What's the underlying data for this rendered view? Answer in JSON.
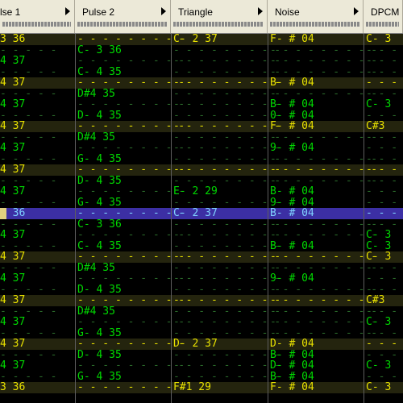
{
  "channels": [
    {
      "name": "lse 1"
    },
    {
      "name": "Pulse 2"
    },
    {
      "name": "Triangle"
    },
    {
      "name": "Noise"
    },
    {
      "name": "DPCM"
    }
  ],
  "rows": [
    {
      "hl": true,
      "cur": false,
      "c": [
        "3 36",
        "",
        "C- 2 37",
        "F- # 04",
        "C- 3"
      ]
    },
    {
      "hl": false,
      "cur": false,
      "c": [
        "",
        "C- 3 36",
        "",
        "",
        ""
      ]
    },
    {
      "hl": false,
      "cur": false,
      "c": [
        "4 37",
        "",
        "",
        "",
        ""
      ]
    },
    {
      "hl": false,
      "cur": false,
      "c": [
        "",
        "C- 4 35",
        "",
        "",
        ""
      ]
    },
    {
      "hl": true,
      "cur": false,
      "c": [
        "4 37",
        "",
        "",
        "B- # 04",
        ""
      ]
    },
    {
      "hl": false,
      "cur": false,
      "c": [
        "",
        "D#4 35",
        "",
        "",
        ""
      ]
    },
    {
      "hl": false,
      "cur": false,
      "c": [
        "4 37",
        "",
        "",
        "B- # 04",
        "C- 3"
      ]
    },
    {
      "hl": false,
      "cur": false,
      "c": [
        "",
        "D- 4 35",
        "",
        "0- # 04",
        ""
      ]
    },
    {
      "hl": true,
      "cur": false,
      "c": [
        "4 37",
        "",
        "",
        "F- # 04",
        "C#3"
      ]
    },
    {
      "hl": false,
      "cur": false,
      "c": [
        "",
        "D#4 35",
        "",
        "",
        ""
      ]
    },
    {
      "hl": false,
      "cur": false,
      "c": [
        "4 37",
        "",
        "",
        "9- # 04",
        ""
      ]
    },
    {
      "hl": false,
      "cur": false,
      "c": [
        "",
        "G- 4 35",
        "",
        "",
        ""
      ]
    },
    {
      "hl": true,
      "cur": false,
      "c": [
        "4 37",
        "",
        "",
        "",
        ""
      ]
    },
    {
      "hl": false,
      "cur": false,
      "c": [
        "",
        "D- 4 35",
        "",
        "",
        ""
      ]
    },
    {
      "hl": false,
      "cur": false,
      "c": [
        "4 37",
        "",
        "E- 2 29",
        "B- # 04",
        ""
      ]
    },
    {
      "hl": false,
      "cur": false,
      "c": [
        "",
        "G- 4 35",
        "",
        "9- # 04",
        ""
      ]
    },
    {
      "hl": false,
      "cur": true,
      "c": [
        "3 36",
        "",
        "C- 2 37",
        "B- # 04",
        ""
      ]
    },
    {
      "hl": false,
      "cur": false,
      "c": [
        "",
        "C- 3 36",
        "",
        "",
        ""
      ]
    },
    {
      "hl": false,
      "cur": false,
      "c": [
        "4 37",
        "",
        "",
        "",
        "C- 3"
      ]
    },
    {
      "hl": false,
      "cur": false,
      "c": [
        "",
        "C- 4 35",
        "",
        "B- # 04",
        "C- 3"
      ]
    },
    {
      "hl": true,
      "cur": false,
      "c": [
        "4 37",
        "",
        "",
        "",
        "C- 3"
      ]
    },
    {
      "hl": false,
      "cur": false,
      "c": [
        "",
        "D#4 35",
        "",
        "",
        ""
      ]
    },
    {
      "hl": false,
      "cur": false,
      "c": [
        "4 37",
        "",
        "",
        "9- # 04",
        ""
      ]
    },
    {
      "hl": false,
      "cur": false,
      "c": [
        "",
        "D- 4 35",
        "",
        "",
        ""
      ]
    },
    {
      "hl": true,
      "cur": false,
      "c": [
        "4 37",
        "",
        "",
        "",
        "C#3"
      ]
    },
    {
      "hl": false,
      "cur": false,
      "c": [
        "",
        "D#4 35",
        "",
        "",
        ""
      ]
    },
    {
      "hl": false,
      "cur": false,
      "c": [
        "4 37",
        "",
        "",
        "",
        "C- 3"
      ]
    },
    {
      "hl": false,
      "cur": false,
      "c": [
        "",
        "G- 4 35",
        "",
        "",
        ""
      ]
    },
    {
      "hl": true,
      "cur": false,
      "c": [
        "4 37",
        "",
        "D- 2 37",
        "D- # 04",
        ""
      ]
    },
    {
      "hl": false,
      "cur": false,
      "c": [
        "",
        "D- 4 35",
        "",
        "B- # 04",
        ""
      ]
    },
    {
      "hl": false,
      "cur": false,
      "c": [
        "4 37",
        "",
        "",
        "D- # 04",
        "C- 3"
      ]
    },
    {
      "hl": false,
      "cur": false,
      "c": [
        "",
        "G- 4 35",
        "",
        "B- # 04",
        ""
      ]
    },
    {
      "hl": true,
      "cur": false,
      "c": [
        "3 36",
        "",
        "F#1 29",
        "F- # 04",
        "C- 3"
      ]
    }
  ]
}
